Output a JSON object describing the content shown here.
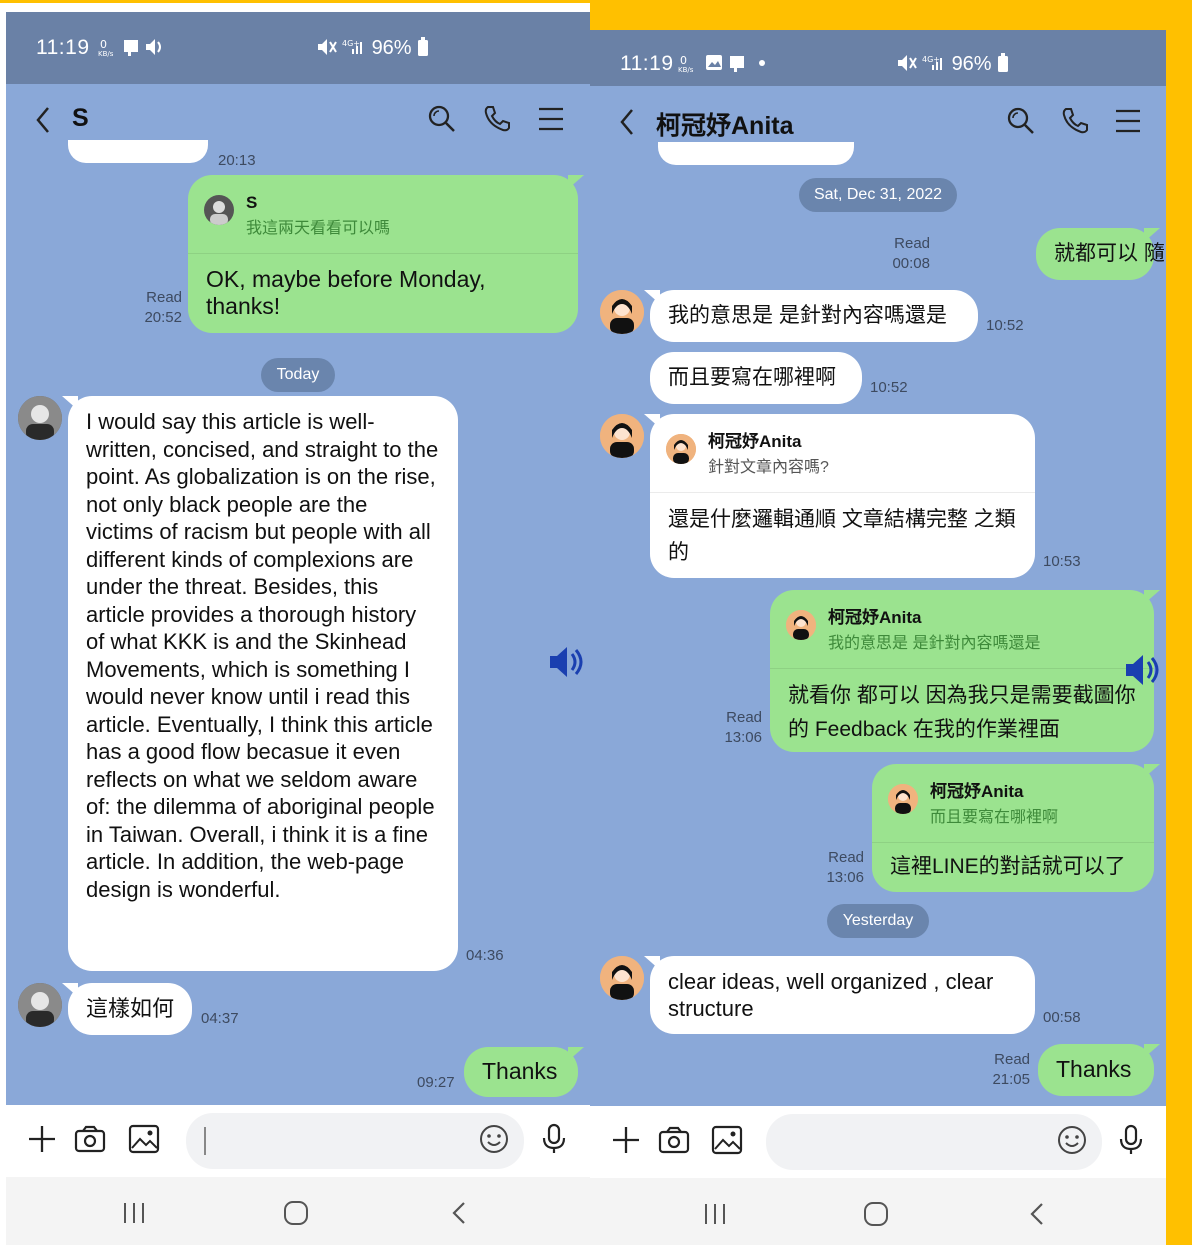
{
  "left": {
    "status": {
      "time": "11:19",
      "battery": "96%",
      "net_speed": "0 KB/s"
    },
    "header": {
      "title": "S"
    },
    "messages": {
      "partial_time": "20:13",
      "reply_name": "S",
      "reply_quote": "我這兩天看看可以嗎",
      "reply_body": "OK, maybe before Monday, thanks!",
      "reply_read": "Read",
      "reply_time": "20:52",
      "date_pill": "Today",
      "long_msg": "I would say this article is well-written, concised, and straight to the point. As globalization is on the rise, not only black people are the victims of racism but people with all different kinds of complexions are under the threat. Besides, this article provides a thorough history of what KKK is and the Skinhead Movements, which is something I would never know until i read this article. Eventually, I think this article has a good flow becasue it even reflects on what we seldom aware of: the dilemma of aboriginal people in Taiwan. Overall, i think it is a fine article. In addition, the web-page design is wonderful.",
      "long_time": "04:36",
      "short_msg": "這樣如何",
      "short_time": "04:37",
      "thanks_msg": "Thanks",
      "thanks_time": "09:27"
    },
    "input": {
      "placeholder": ""
    }
  },
  "right": {
    "status": {
      "time": "11:19",
      "battery": "96%",
      "net_speed": "0 KB/s"
    },
    "header": {
      "title": "柯冠妤Anita"
    },
    "messages": {
      "date1": "Sat, Dec 31, 2022",
      "m1_read": "Read",
      "m1_time": "00:08",
      "m1": "就都可以 隨意發揮",
      "m2": "我的意思是 是針對內容嗎還是",
      "m2_time": "10:52",
      "m3": "而且要寫在哪裡啊",
      "m3_time": "10:52",
      "m4_reply_name": "柯冠妤Anita",
      "m4_reply_quote": "針對文章內容嗎?",
      "m4": "還是什麼邏輯通順 文章結構完整 之類的",
      "m4_time": "10:53",
      "m5_reply_name": "柯冠妤Anita",
      "m5_reply_quote": "我的意思是 是針對內容嗎還是",
      "m5": "就看你 都可以 因為我只是需要截圖你的 Feedback 在我的作業裡面",
      "m5_read": "Read",
      "m5_time": "13:06",
      "m6_reply_name": "柯冠妤Anita",
      "m6_reply_quote": "而且要寫在哪裡啊",
      "m6": "這裡LINE的對話就可以了",
      "m6_read": "Read",
      "m6_time": "13:06",
      "date2": "Yesterday",
      "m7": "clear ideas, well organized , clear structure",
      "m7_time": "00:58",
      "m8_read": "Read",
      "m8_time": "21:05",
      "m8": "Thanks"
    },
    "input": {
      "placeholder": ""
    }
  },
  "colors": {
    "chat_bg": "#8aa8d8",
    "status_bg": "#6a81a6",
    "sent_bubble": "#9be38f",
    "received_bubble": "#ffffff",
    "frame_accent": "#ffc000"
  }
}
